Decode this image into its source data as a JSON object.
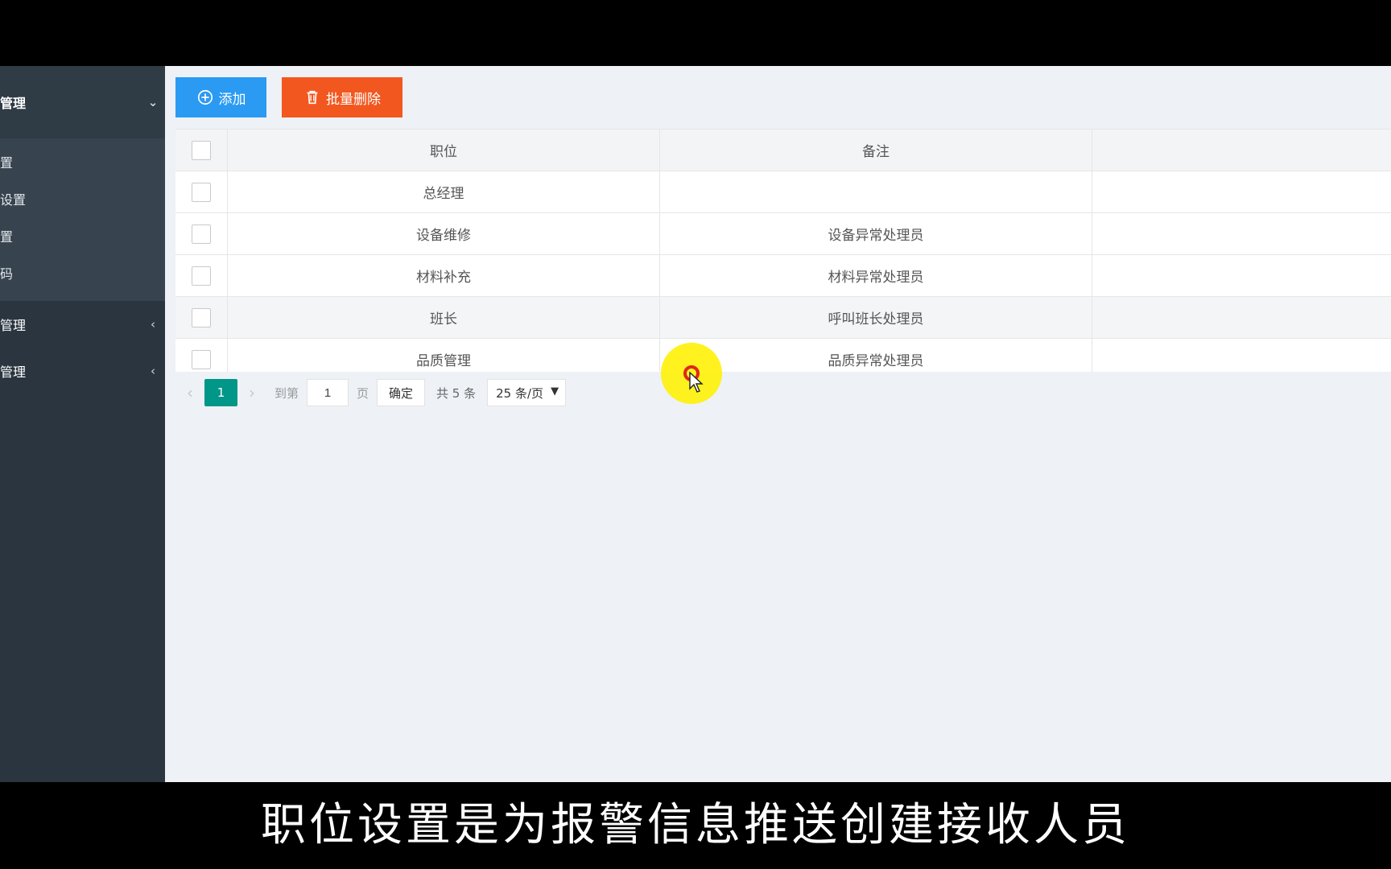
{
  "sidebar": {
    "open_group_label": "管理",
    "sub_items": [
      "置",
      "设置",
      "置",
      "码"
    ],
    "groups": [
      {
        "label": "管理"
      },
      {
        "label": "管理"
      }
    ]
  },
  "toolbar": {
    "add_label": "添加",
    "delete_label": "批量删除",
    "add_color": "#2b9af3",
    "delete_color": "#f2571f"
  },
  "table": {
    "columns": [
      "职位",
      "备注"
    ],
    "rows": [
      {
        "position": "总经理",
        "note": ""
      },
      {
        "position": "设备维修",
        "note": "设备异常处理员"
      },
      {
        "position": "材料补充",
        "note": "材料异常处理员"
      },
      {
        "position": "班长",
        "note": "呼叫班长处理员"
      },
      {
        "position": "品质管理",
        "note": "品质异常处理员"
      }
    ]
  },
  "pager": {
    "current_page": "1",
    "goto_label": "到第",
    "goto_value": "1",
    "page_unit": "页",
    "ok_label": "确定",
    "total_text": "共 5 条",
    "page_size": "25 条/页",
    "accent_color": "#009688"
  },
  "subtitle": "职位设置是为报警信息推送创建接收人员"
}
